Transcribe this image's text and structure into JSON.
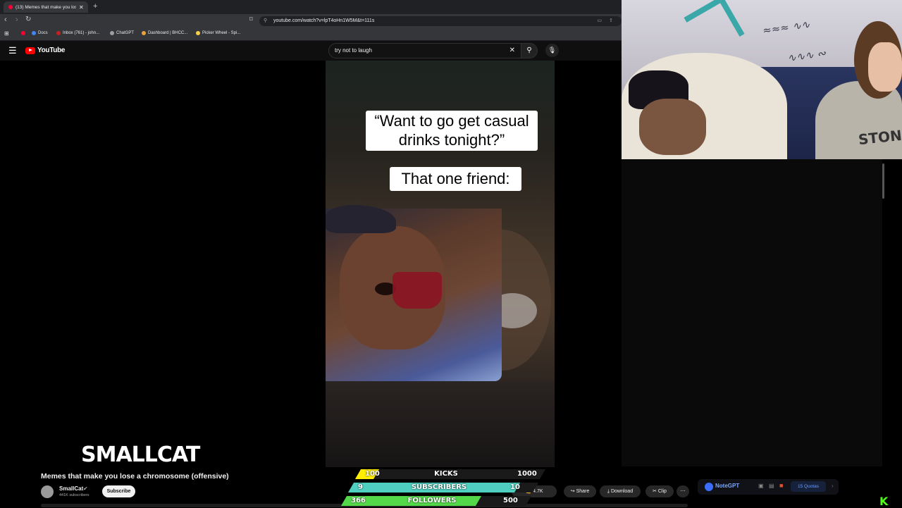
{
  "browser": {
    "tab_title": "(13) Memes that make you lose",
    "new_tab_label": "+",
    "url": "youtube.com/watch?v=lpT4oHn1W5M&t=111s",
    "bookmarks": [
      "Docs",
      "Inbox (761) - john...",
      "ChatGPT",
      "Dashboard | BHCC...",
      "Picker Wheel - Spi..."
    ]
  },
  "youtube": {
    "logo_text": "YouTube",
    "search_query": "try not to laugh",
    "video": {
      "caption_top": "“Want to go get casual drinks tonight?”",
      "caption_bottom": "That one friend:"
    },
    "video_title": "Memes that make you lose a chromosome (offensive)",
    "channel_name": "SmallCat",
    "subscriber_count": "441K subscribers",
    "subscribe_label": "Subscribe",
    "like_count": "4.7K",
    "actions": {
      "share": "Share",
      "download": "Download",
      "clip": "Clip",
      "more": "⋯"
    }
  },
  "overlay": {
    "streamer_name": "SMALLCAT",
    "goals": [
      {
        "label": "KICKS",
        "current": "100",
        "target": "1000",
        "color": "#ffee00",
        "progress": 0.1
      },
      {
        "label": "SUBSCRIBERS",
        "current": "9",
        "target": "10",
        "color": "#4ecfc0",
        "progress": 0.9
      },
      {
        "label": "FOLLOWERS",
        "current": "366",
        "target": "500",
        "color": "#53d84a",
        "progress": 0.73
      }
    ]
  },
  "notegpt": {
    "label": "NoteGPT",
    "quota": "15 Quotas"
  },
  "webcam": {
    "shirt_text": "STON"
  },
  "kick_logo": "K"
}
